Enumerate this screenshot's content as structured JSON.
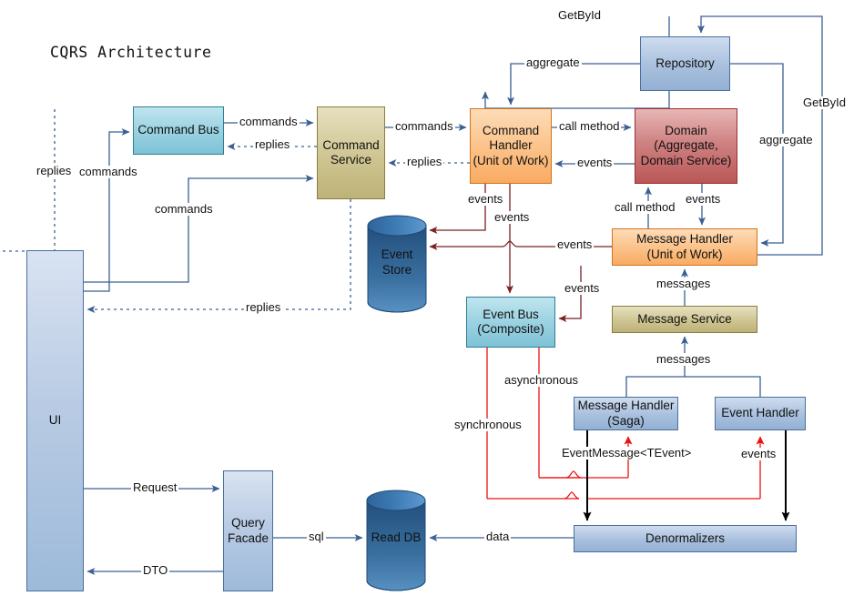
{
  "diagram": {
    "title": "CQRS Architecture",
    "colors": {
      "blue_line": "#3a5f92",
      "dark_red_line": "#7a2020",
      "red_line": "#ee1111",
      "black_line": "#000000",
      "node_blue": "#a8c0dd",
      "node_cyan": "#9bd2e2",
      "node_khaki": "#cfc592",
      "node_orange": "#fbc187",
      "node_red": "#cf8282",
      "cylinder_blue": "#2c5f92"
    },
    "nodes": [
      {
        "id": "ui",
        "label": "UI"
      },
      {
        "id": "command-bus",
        "label": "Command Bus"
      },
      {
        "id": "command-service",
        "label": "Command\nService"
      },
      {
        "id": "command-handler",
        "label": "Command\nHandler\n(Unit of Work)"
      },
      {
        "id": "domain",
        "label": "Domain\n(Aggregate,\nDomain Service)"
      },
      {
        "id": "repository",
        "label": "Repository"
      },
      {
        "id": "event-store",
        "label": "Event\nStore"
      },
      {
        "id": "event-bus",
        "label": "Event Bus\n(Composite)"
      },
      {
        "id": "message-handler-uow",
        "label": "Message Handler\n(Unit of Work)"
      },
      {
        "id": "message-service",
        "label": "Message Service"
      },
      {
        "id": "message-handler-saga",
        "label": "Message Handler\n(Saga)"
      },
      {
        "id": "event-handler",
        "label": "Event Handler"
      },
      {
        "id": "denormalizers",
        "label": "Denormalizers"
      },
      {
        "id": "query-facade",
        "label": "Query\nFacade"
      },
      {
        "id": "read-db",
        "label": "Read DB"
      }
    ],
    "node_labels": {
      "ui": "UI",
      "command_bus": "Command Bus",
      "command_service_l1": "Command",
      "command_service_l2": "Service",
      "command_handler_l1": "Command",
      "command_handler_l2": "Handler",
      "command_handler_l3": "(Unit of Work)",
      "domain_l1": "Domain",
      "domain_l2": "(Aggregate,",
      "domain_l3": "Domain Service)",
      "repository": "Repository",
      "event_store_l1": "Event",
      "event_store_l2": "Store",
      "event_bus_l1": "Event Bus",
      "event_bus_l2": "(Composite)",
      "message_handler_uow_l1": "Message Handler",
      "message_handler_uow_l2": "(Unit of Work)",
      "message_service": "Message Service",
      "message_handler_saga_l1": "Message Handler",
      "message_handler_saga_l2": "(Saga)",
      "event_handler": "Event Handler",
      "denormalizers": "Denormalizers",
      "query_facade_l1": "Query",
      "query_facade_l2": "Facade",
      "read_db": "Read DB"
    },
    "edge_labels": {
      "getbyid_top": "GetById",
      "getbyid_right": "GetById",
      "aggregate_left": "aggregate",
      "aggregate_right": "aggregate",
      "commands_bus_to_service": "commands",
      "commands_service_to_handler": "commands",
      "commands_ui_left": "commands",
      "commands_ui_lower": "commands",
      "replies_left": "replies",
      "replies_bus": "replies",
      "replies_handler": "replies",
      "replies_bottom": "replies",
      "call_method_domain": "call method",
      "call_method_msg": "call method",
      "events_domain_to_ch": "events",
      "events_ch_left": "events",
      "events_ch_down": "events",
      "events_to_store": "events",
      "events_mh_to_store": "events",
      "events_domain_to_mh": "events",
      "events_mh_to_bus": "events",
      "messages_ms_to_mh": "messages",
      "messages_handlers_to_ms": "messages",
      "asynchronous": "asynchronous",
      "synchronous": "synchronous",
      "event_message": "EventMessage<TEvent>",
      "events_handler_red": "events",
      "request": "Request",
      "dto": "DTO",
      "sql": "sql",
      "data": "data"
    }
  }
}
